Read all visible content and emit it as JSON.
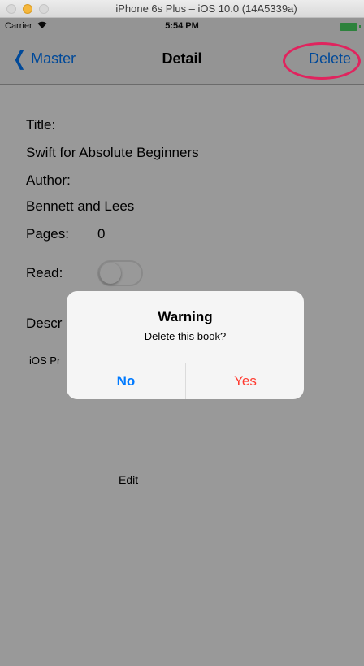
{
  "simulator": {
    "title": "iPhone 6s Plus – iOS 10.0 (14A5339a)"
  },
  "status_bar": {
    "carrier": "Carrier",
    "wifi_icon": "⊘",
    "time": "5:54 PM"
  },
  "nav": {
    "back_icon": "❮",
    "back_label": "Master",
    "title": "Detail",
    "delete_label": "Delete"
  },
  "detail": {
    "title_label": "Title:",
    "title_value": "Swift for Absolute Beginners",
    "author_label": "Author:",
    "author_value": "Bennett and Lees",
    "pages_label": "Pages:",
    "pages_value": "0",
    "read_label": "Read:",
    "description_label": "Descr",
    "description_value": "iOS Pr",
    "edit_label": "Edit"
  },
  "alert": {
    "title": "Warning",
    "message": "Delete this book?",
    "no_label": "No",
    "yes_label": "Yes"
  },
  "colors": {
    "tint": "#007aff",
    "destructive": "#ff3b30",
    "highlight": "#e0245e",
    "battery": "#4cd964"
  }
}
